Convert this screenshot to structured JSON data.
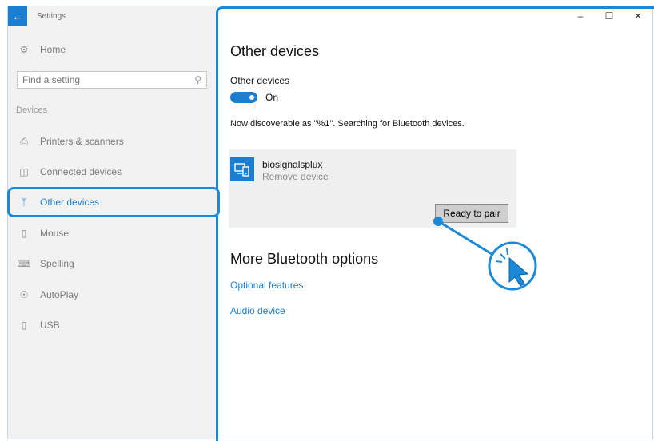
{
  "titlebar": {
    "back_icon": "back-arrow-icon",
    "app_title": "Settings"
  },
  "window_controls": {
    "minimize": "–",
    "maximize": "☐",
    "close": "✕"
  },
  "sidebar": {
    "home": {
      "icon": "gear-icon",
      "label": "Home"
    },
    "search": {
      "placeholder": "Find a setting",
      "icon": "search-icon"
    },
    "group_label": "Devices",
    "items": [
      {
        "icon": "printer-icon",
        "label": "Printers & scanners",
        "active": false
      },
      {
        "icon": "connected-devices-icon",
        "label": "Connected devices",
        "active": false
      },
      {
        "icon": "bluetooth-icon",
        "label": "Other devices",
        "active": true
      },
      {
        "icon": "mouse-icon",
        "label": "Mouse",
        "active": false
      },
      {
        "icon": "keyboard-icon",
        "label": "Spelling",
        "active": false
      },
      {
        "icon": "autoplay-icon",
        "label": "AutoPlay",
        "active": false
      },
      {
        "icon": "usb-icon",
        "label": "USB",
        "active": false
      }
    ]
  },
  "main": {
    "title": "Other devices",
    "toggle_section_label": "Other devices",
    "toggle_state": "On",
    "discoverable_text": "Now discoverable as \"%1\". Searching for Bluetooth devices.",
    "device": {
      "icon": "device-icon",
      "name": "biosignalsplux",
      "action": "Remove device",
      "pair_button": "Ready to pair"
    },
    "more_title": "More Bluetooth options",
    "links": [
      "Optional features",
      "Audio device"
    ]
  },
  "colors": {
    "accent": "#1a7fd3",
    "annotation": "#1a8ad8",
    "sidebar_bg": "#f2f2f2"
  }
}
